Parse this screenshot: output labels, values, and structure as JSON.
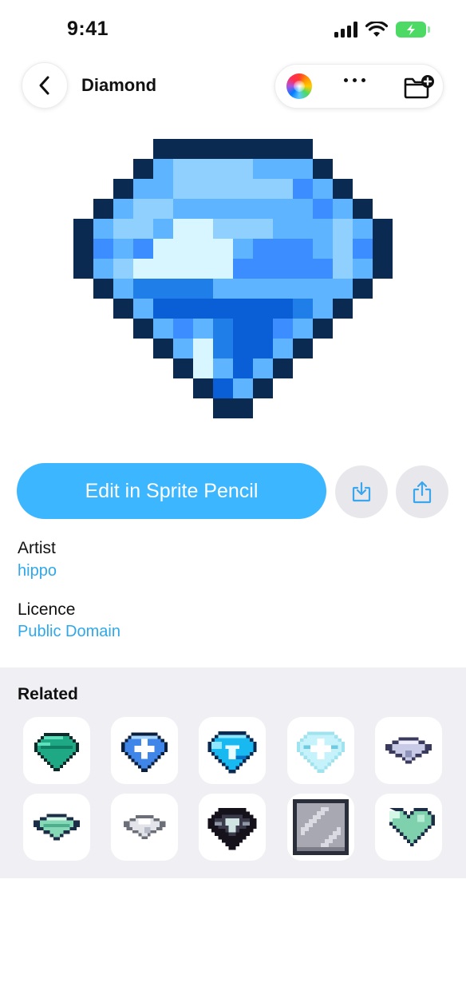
{
  "status_bar": {
    "time": "9:41"
  },
  "nav": {
    "title": "Diamond"
  },
  "actions": {
    "edit_label": "Edit in Sprite Pencil"
  },
  "meta": {
    "artist_label": "Artist",
    "artist_value": "hippo",
    "licence_label": "Licence",
    "licence_value": "Public Domain"
  },
  "related": {
    "title": "Related",
    "items": [
      "green-gem",
      "blue-sparkle-gem",
      "cyan-gem",
      "ice-gem",
      "grey-gem",
      "mint-gem",
      "white-gem",
      "dark-gem",
      "silver-block",
      "mint-heart"
    ]
  },
  "colors": {
    "accent": "#3bb6ff",
    "link": "#2fa8ea",
    "related_bg": "#f0f0f4"
  }
}
